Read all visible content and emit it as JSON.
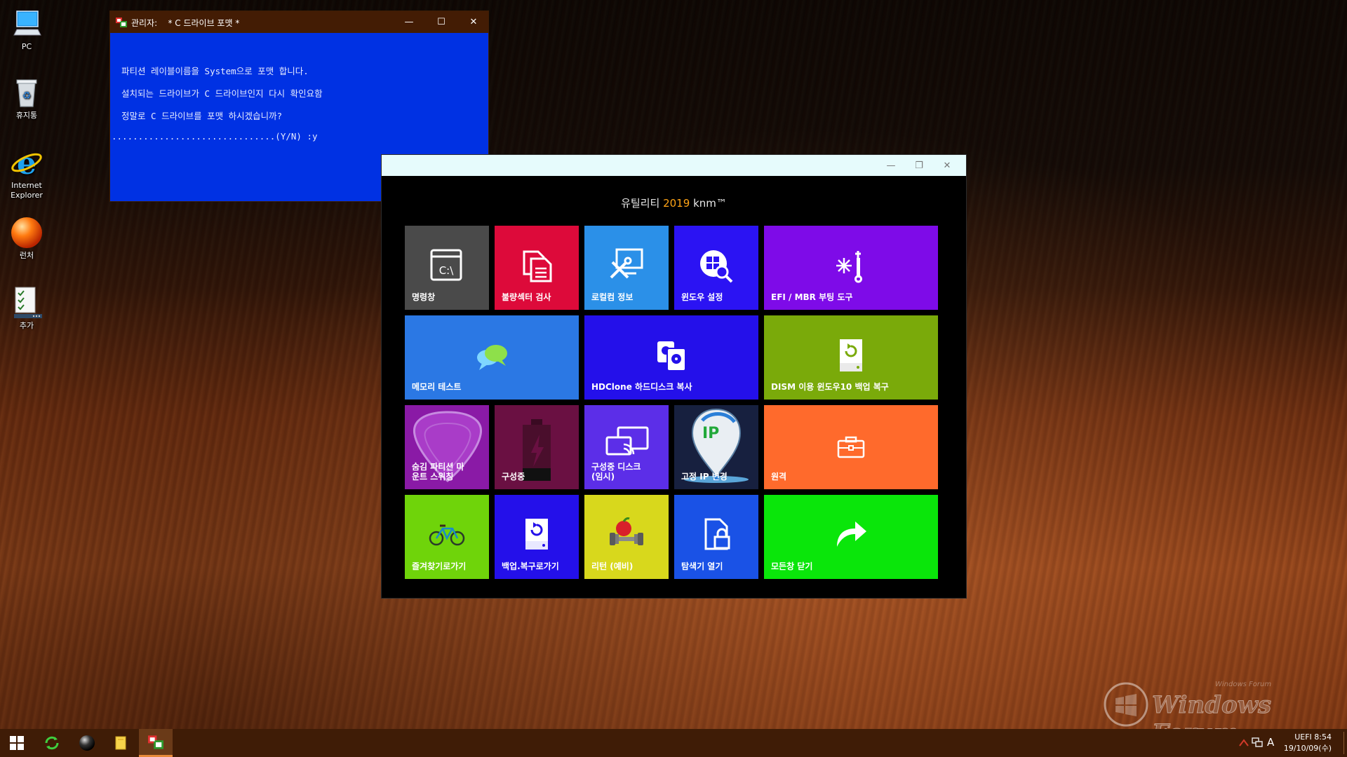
{
  "desktop": {
    "icons": [
      {
        "label": "PC"
      },
      {
        "label": "휴지통"
      },
      {
        "label": "Internet\nExplorer"
      },
      {
        "label": "런처"
      },
      {
        "label": "추가"
      }
    ]
  },
  "console": {
    "title_prefix": "관리자:",
    "title": "* C 드라이브 포맷 *",
    "lines": [
      "파티션 레이블이름을 System으로 포맷 합니다.",
      "설치되는 드라이브가 C 드라이브인지 다시 확인요함",
      "정말로 C 드라이브를 포맷 하시겠습니까?",
      "...............................(Y/N) :y"
    ],
    "minimize": "—",
    "maximize": "☐",
    "close": "✕"
  },
  "utility": {
    "title_left": "유틸리티",
    "title_year": "2019",
    "title_right": "knm™",
    "minimize": "—",
    "restore": "❐",
    "close": "✕",
    "tiles": [
      {
        "label": "명령창",
        "color": "#4a4a4a",
        "icon": "cmd-icon"
      },
      {
        "label": "불량섹터 검사",
        "color": "#dd0a3a",
        "icon": "document-copy-icon"
      },
      {
        "label": "로컬컴 정보",
        "color": "#2b90e8",
        "icon": "tools-monitor-icon"
      },
      {
        "label": "윈도우 설정",
        "color": "#2b13f3",
        "icon": "windows-search-icon"
      },
      {
        "label": "EFI / MBR 부팅 도구",
        "color": "#7e0be8",
        "icon": "wrench-spark-icon"
      },
      {
        "label": "메모리 테스트",
        "color": "#2b78e4",
        "icon": "chat-bubbles-icon"
      },
      {
        "label": "HDClone 하드디스크 복사",
        "color": "#2410ea",
        "icon": "disk-clone-icon"
      },
      {
        "label": "DISM 이용 윈도우10 백업 복구",
        "color": "#7aaa0a",
        "icon": "drive-restore-icon"
      },
      {
        "label": "숨김 파티션 마\n운트 스위칭",
        "color": "#8a1aa6",
        "icon": "guitar-pick-icon"
      },
      {
        "label": "구성중",
        "color": "#6a1042",
        "icon": "battery-icon"
      },
      {
        "label": "구성중 디스크\n(임시)",
        "color": "#5c2ee8",
        "icon": "cast-screen-icon"
      },
      {
        "label": "고정 IP 변경",
        "color": "#17203f",
        "icon": "ip-pin-icon",
        "ip_text": "IP"
      },
      {
        "label": "원격",
        "color": "#ff6a2c",
        "icon": "briefcase-icon"
      },
      {
        "label": "즐겨찾기로가기",
        "color": "#6fd40a",
        "icon": "bicycle-icon"
      },
      {
        "label": "백업.복구로가기",
        "color": "#2410ea",
        "icon": "drive-backup-icon"
      },
      {
        "label": "리턴 (예비)",
        "color": "#d8d81c",
        "icon": "apple-dumbbell-icon"
      },
      {
        "label": "탐색기 열기",
        "color": "#1a52e6",
        "icon": "file-lock-icon"
      },
      {
        "label": "모든창 닫기",
        "color": "#0ae60a",
        "icon": "share-arrow-icon"
      }
    ]
  },
  "watermark": {
    "text": "Windows Forum",
    "sub": "Windows Forum"
  },
  "taskbar": {
    "items": [
      {
        "icon": "windows-start-icon"
      },
      {
        "icon": "refresh-icon"
      },
      {
        "icon": "sphere-icon"
      },
      {
        "icon": "folder-icon"
      },
      {
        "icon": "console-app-icon"
      }
    ],
    "tray_lang": "A",
    "clock_line1": "UEFI  8:54",
    "clock_line2": "19/10/09(수)"
  },
  "colors": {
    "console_bg": "#0031e3",
    "console_title": "#431c04",
    "util_title": "#e6fbfc",
    "taskbar": "#3f1c06",
    "accent_year": "#ffa416"
  }
}
